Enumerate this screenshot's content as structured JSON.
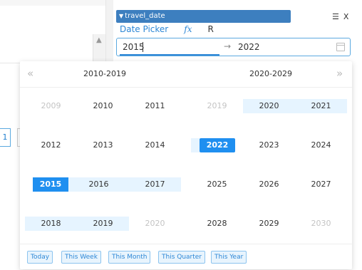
{
  "filter": {
    "title": "travel_date",
    "header_icons": {
      "list": "☰",
      "close": "X"
    },
    "tabs": [
      {
        "label": "Date Picker"
      },
      {
        "label": "fx"
      },
      {
        "label": "R"
      }
    ],
    "range": {
      "start_value": "2015",
      "separator": "→",
      "end_value": "2022"
    }
  },
  "background": {
    "page_chips": [
      "1",
      ""
    ]
  },
  "calendar": {
    "prev_icon": "«",
    "next_icon": "»",
    "left_decade": "2010-2019",
    "right_decade": "2020-2029",
    "left_years": [
      "2009",
      "2010",
      "2011",
      "2012",
      "2013",
      "2014",
      "2015",
      "2016",
      "2017",
      "2018",
      "2019",
      "2020"
    ],
    "right_years": [
      "2019",
      "2020",
      "2021",
      "2022",
      "2023",
      "2024",
      "2025",
      "2026",
      "2027",
      "2028",
      "2029",
      "2030"
    ],
    "selected_start": "2015",
    "selected_end": "2022"
  },
  "presets": [
    "Today",
    "This Week",
    "This Month",
    "This Quarter",
    "This Year"
  ],
  "colors": {
    "accent": "#1f8ff0",
    "header_bg": "#3d7fbf",
    "range_bg": "#e6f4ff",
    "preset_bg": "#e8f4fd"
  }
}
